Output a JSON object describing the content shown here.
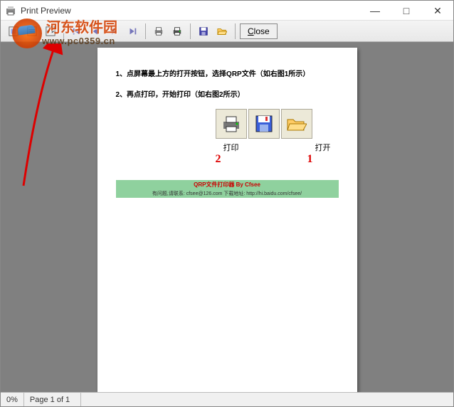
{
  "title": "Print Preview",
  "windowControls": {
    "min": "—",
    "max": "□",
    "close": "✕"
  },
  "toolbar": {
    "icons": {
      "zoomfit": "zoom-fit-icon",
      "zoom100": "zoom-100-icon",
      "zoomwidth": "zoom-width-icon",
      "first": "nav-first-icon",
      "prev": "nav-prev-icon",
      "next": "nav-next-icon",
      "last": "nav-last-icon",
      "setup": "print-setup-icon",
      "print": "print-icon",
      "save": "save-icon",
      "open": "open-icon"
    },
    "closeLabel": "Close"
  },
  "page": {
    "line1": "1、点屏幕最上方的打开按钮，选择QRP文件（如右图1所示）",
    "line2": "2、再点打印，开始打印（如右图2所示）",
    "iconLabels": {
      "print": "打印",
      "open": "打开"
    },
    "redNums": {
      "print": "2",
      "open": "1"
    },
    "banner1": "QRP文件打印器 By Cfsee",
    "banner2": "有问题,请联系: cfsee@126.com    下载地址: http://hi.baidu.com/cfsee/"
  },
  "status": {
    "percent": "0%",
    "page": "Page 1 of 1"
  },
  "watermark": {
    "name": "河东软件园",
    "url": "www.pc0359.cn"
  },
  "colors": {
    "gray": "#808080",
    "toolbarBg": "#e8e8e8",
    "banner": "#8fd19e",
    "red": "#d00"
  }
}
